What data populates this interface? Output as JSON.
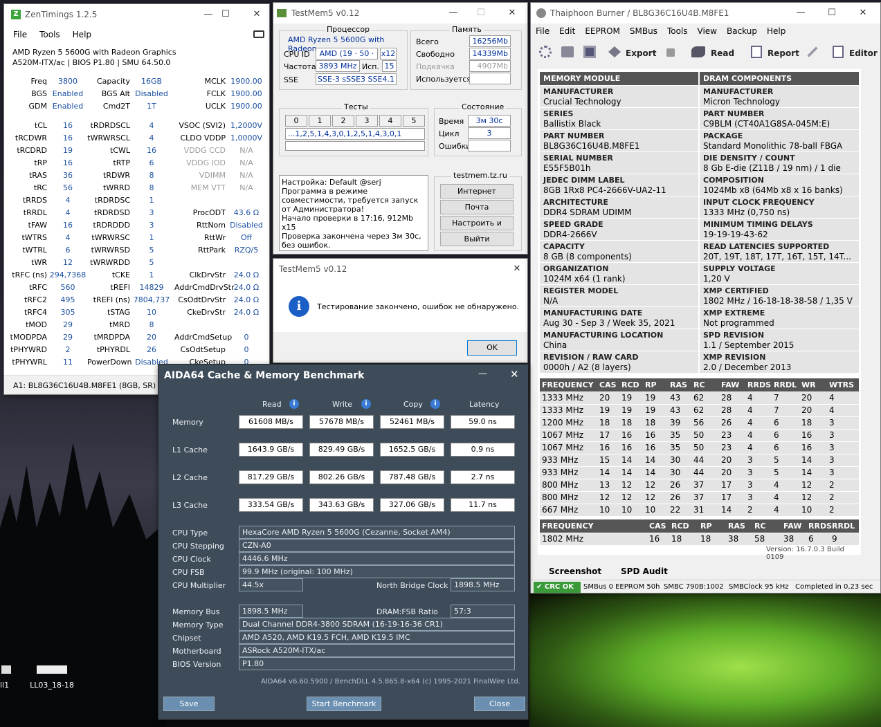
{
  "desktop": {
    "icon1_label": "ll1",
    "icon2_label": "LL03_18-18"
  },
  "zen": {
    "title": "ZenTimings 1.2.5",
    "menu": [
      "File",
      "Tools",
      "Help"
    ],
    "cpu": "AMD Ryzen 5 5600G with Radeon Graphics",
    "board": "A520M-ITX/ac | BIOS P1.80 | SMU 64.50.0",
    "status": "A1: BL8G36C16U4B.M8FE1 (8GB, SR)",
    "rows1": [
      [
        "Freq",
        "3800",
        "Capacity",
        "16GB",
        "MCLK",
        "1900.00"
      ],
      [
        "BGS",
        "Enabled",
        "BGS Alt",
        "Disabled",
        "FCLK",
        "1900.00"
      ],
      [
        "GDM",
        "Enabled",
        "Cmd2T",
        "1T",
        "UCLK",
        "1900.00"
      ]
    ],
    "rows2": [
      [
        "tCL",
        "16",
        "tRDRDSCL",
        "4",
        "VSOC (SVI2)",
        "1,2000V"
      ],
      [
        "tRCDWR",
        "16",
        "tWRWRSCL",
        "4",
        "CLDO VDDP",
        "1,0000V"
      ],
      [
        "tRCDRD",
        "19",
        "tCWL",
        "16",
        "VDDG CCD",
        "N/A"
      ],
      [
        "tRP",
        "16",
        "tRTP",
        "6",
        "VDDG IOD",
        "N/A"
      ],
      [
        "tRAS",
        "36",
        "tRDWR",
        "8",
        "VDIMM",
        "N/A"
      ],
      [
        "tRC",
        "56",
        "tWRRD",
        "8",
        "MEM VTT",
        "N/A"
      ],
      [
        "tRRDS",
        "4",
        "tRDRDSC",
        "1",
        "",
        ""
      ],
      [
        "tRRDL",
        "4",
        "tRDRDSD",
        "3",
        "ProcODT",
        "43.6 Ω"
      ],
      [
        "tFAW",
        "16",
        "tRDRDDD",
        "3",
        "RttNom",
        "Disabled"
      ],
      [
        "tWTRS",
        "4",
        "tWRWRSC",
        "1",
        "RttWr",
        "Off"
      ],
      [
        "tWTRL",
        "6",
        "tWRWRSD",
        "5",
        "RttPark",
        "RZQ/5"
      ],
      [
        "tWR",
        "12",
        "tWRWRDD",
        "5",
        "",
        ""
      ],
      [
        "tRFC (ns)",
        "294,7368",
        "tCKE",
        "1",
        "ClkDrvStr",
        "24.0 Ω"
      ],
      [
        "tRFC",
        "560",
        "tREFI",
        "14829",
        "AddrCmdDrvStr",
        "24.0 Ω"
      ],
      [
        "tRFC2",
        "495",
        "tREFI (ns)",
        "7804,737",
        "CsOdtDrvStr",
        "24.0 Ω"
      ],
      [
        "tRFC4",
        "305",
        "tSTAG",
        "10",
        "CkeDrvStr",
        "24.0 Ω"
      ],
      [
        "tMOD",
        "29",
        "tMRD",
        "8",
        "",
        ""
      ],
      [
        "tMODPDA",
        "29",
        "tMRDPDA",
        "20",
        "AddrCmdSetup",
        "0"
      ],
      [
        "tPHYWRD",
        "2",
        "tPHYRDL",
        "26",
        "CsOdtSetup",
        "0"
      ],
      [
        "tPHYWRL",
        "11",
        "PowerDown",
        "Disabled",
        "CkeSetup",
        "0"
      ]
    ]
  },
  "tm5": {
    "title": "TestMem5 v0.12",
    "proc_group": "Процессор",
    "cpu": "AMD Ryzen 5 5600G with Radeon",
    "cpu_id_label": "CPU ID",
    "cpu_id": "AMD  (19 · 50 · 0)",
    "cpu_id_x": "x12",
    "freq_label": "Частота",
    "freq": "3893 MHz",
    "isp_label": "Исп.",
    "isp": "15",
    "sse_label": "SSE",
    "sse": "SSE-3 sSSE3 SSE4.1",
    "mem_group": "Память",
    "total_label": "Всего",
    "total": "16256Mb",
    "free_label": "Свободно",
    "free": "14339Mb",
    "swap_label": "Подкачка",
    "swap": "4907Mb",
    "used_label": "Используется",
    "used": "",
    "tests_group": "Тесты",
    "tests": [
      "0",
      "1",
      "2",
      "3",
      "4",
      "5"
    ],
    "sequence": "...1,2,5,1,4,3,0,1,2,5,1,4,3,0,1",
    "state_group": "Состояние",
    "time_label": "Время",
    "time": "3м 30с",
    "cycle_label": "Цикл",
    "cycle": "3",
    "errors_label": "Ошибки",
    "errors": "",
    "log": "Настройка: Default @serj\nПрограмма в режиме совместимости, требуется запуск от Администратора!\nНачало проверки в 17:16, 912Mb x15\nПроверка закончена через 3м 30с, без ошибок.",
    "site": "testmem.tz.ru",
    "btn_internet": "Интернет",
    "btn_mail": "Почта",
    "btn_setup_exit": "Настроить и выйти",
    "btn_exit": "Выйти"
  },
  "dlg": {
    "title": "TestMem5 v0.12",
    "message": "Тестирование закончено, ошибок не обнаружено.",
    "ok": "OK"
  },
  "thai": {
    "title": "Thaiphoon Burner / BL8G36C16U4B.M8FE1",
    "menu": [
      "File",
      "Edit",
      "EEPROM",
      "SMBus",
      "Tools",
      "View",
      "Backup",
      "Help"
    ],
    "export": "Export",
    "read": "Read",
    "report": "Report",
    "editor": "Editor",
    "left_header": "MEMORY MODULE",
    "right_header": "DRAM COMPONENTS",
    "left": [
      [
        "MANUFACTURER",
        "Crucial Technology"
      ],
      [
        "SERIES",
        "Ballistix Black"
      ],
      [
        "PART NUMBER",
        "BL8G36C16U4B.M8FE1"
      ],
      [
        "SERIAL NUMBER",
        "E55F5B01h"
      ],
      [
        "JEDEC DIMM LABEL",
        "8GB 1Rx8 PC4-2666V-UA2-11"
      ],
      [
        "ARCHITECTURE",
        "DDR4 SDRAM UDIMM"
      ],
      [
        "SPEED GRADE",
        "DDR4-2666V"
      ],
      [
        "CAPACITY",
        "8 GB (8 components)"
      ],
      [
        "ORGANIZATION",
        "1024M x64 (1 rank)"
      ],
      [
        "REGISTER MODEL",
        "N/A"
      ],
      [
        "MANUFACTURING DATE",
        "Aug 30 - Sep 3 / Week 35, 2021"
      ],
      [
        "MANUFACTURING LOCATION",
        "China"
      ],
      [
        "REVISION / RAW CARD",
        "0000h / A2 (8 layers)"
      ]
    ],
    "right": [
      [
        "MANUFACTURER",
        "Micron Technology"
      ],
      [
        "PART NUMBER",
        "C9BLM (CT40A1G8SA-045M:E)"
      ],
      [
        "PACKAGE",
        "Standard Monolithic 78-ball FBGA"
      ],
      [
        "DIE DENSITY / COUNT",
        "8 Gb E-die (Z11B / 19 nm) / 1 die"
      ],
      [
        "COMPOSITION",
        "1024Mb x8 (64Mb x8 x 16 banks)"
      ],
      [
        "INPUT CLOCK FREQUENCY",
        "1333 MHz (0,750 ns)"
      ],
      [
        "MINIMUM TIMING DELAYS",
        "19-19-19-43-62"
      ],
      [
        "READ LATENCIES SUPPORTED",
        "20T, 19T, 18T, 17T, 16T, 15T, 14T..."
      ],
      [
        "SUPPLY VOLTAGE",
        "1,20 V"
      ],
      [
        "XMP CERTIFIED",
        "1802 MHz / 16-18-18-38-58 / 1,35 V"
      ],
      [
        "XMP EXTREME",
        "Not programmed"
      ],
      [
        "SPD REVISION",
        "1.1 / September 2015"
      ],
      [
        "XMP REVISION",
        "2.0 / December 2013"
      ]
    ],
    "freq_headers": [
      "FREQUENCY",
      "CAS",
      "RCD",
      "RP",
      "RAS",
      "RC",
      "FAW",
      "RRDS",
      "RRDL",
      "WR",
      "WTRS"
    ],
    "freq_rows": [
      [
        "1333 MHz",
        "20",
        "19",
        "19",
        "43",
        "62",
        "28",
        "4",
        "7",
        "20",
        "4"
      ],
      [
        "1333 MHz",
        "19",
        "19",
        "19",
        "43",
        "62",
        "28",
        "4",
        "7",
        "20",
        "4"
      ],
      [
        "1200 MHz",
        "18",
        "18",
        "18",
        "39",
        "56",
        "26",
        "4",
        "6",
        "18",
        "3"
      ],
      [
        "1067 MHz",
        "17",
        "16",
        "16",
        "35",
        "50",
        "23",
        "4",
        "6",
        "16",
        "3"
      ],
      [
        "1067 MHz",
        "16",
        "16",
        "16",
        "35",
        "50",
        "23",
        "4",
        "6",
        "16",
        "3"
      ],
      [
        "933 MHz",
        "15",
        "14",
        "14",
        "30",
        "44",
        "20",
        "3",
        "5",
        "14",
        "3"
      ],
      [
        "933 MHz",
        "14",
        "14",
        "14",
        "30",
        "44",
        "20",
        "3",
        "5",
        "14",
        "3"
      ],
      [
        "800 MHz",
        "13",
        "12",
        "12",
        "26",
        "37",
        "17",
        "3",
        "4",
        "12",
        "2"
      ],
      [
        "800 MHz",
        "12",
        "12",
        "12",
        "26",
        "37",
        "17",
        "3",
        "4",
        "12",
        "2"
      ],
      [
        "667 MHz",
        "10",
        "10",
        "10",
        "22",
        "31",
        "14",
        "2",
        "4",
        "10",
        "2"
      ]
    ],
    "xmp_headers": [
      "FREQUENCY",
      "CAS",
      "RCD",
      "RP",
      "RAS",
      "RC",
      "FAW",
      "RRDS",
      "RRDL"
    ],
    "xmp_row": [
      "1802 MHz",
      "16",
      "18",
      "18",
      "38",
      "58",
      "38",
      "6",
      "9"
    ],
    "version": "Version: 16.7.0.3 Build 0109",
    "tab_screenshot": "Screenshot",
    "tab_spd": "SPD Audit",
    "status": [
      "CRC OK",
      "SMBus 0 EEPROM 50h",
      "SMBC 790B:1002",
      "SMBClock 95 kHz",
      "Completed in 0,23 sec"
    ]
  },
  "aida": {
    "title": "AIDA64 Cache & Memory Benchmark",
    "col_read": "Read",
    "col_write": "Write",
    "col_copy": "Copy",
    "col_latency": "Latency",
    "rows": [
      [
        "Memory",
        "61608 MB/s",
        "57678 MB/s",
        "52461 MB/s",
        "59.0 ns"
      ],
      [
        "L1 Cache",
        "1643.9 GB/s",
        "829.49 GB/s",
        "1652.5 GB/s",
        "0.9 ns"
      ],
      [
        "L2 Cache",
        "817.29 GB/s",
        "802.26 GB/s",
        "787.48 GB/s",
        "2.7 ns"
      ],
      [
        "L3 Cache",
        "333.54 GB/s",
        "343.63 GB/s",
        "327.06 GB/s",
        "11.7 ns"
      ]
    ],
    "cpu_type_label": "CPU Type",
    "cpu_type": "HexaCore AMD Ryzen 5 5600G  (Cezanne, Socket AM4)",
    "cpu_step_label": "CPU Stepping",
    "cpu_step": "CZN-A0",
    "cpu_clock_label": "CPU Clock",
    "cpu_clock": "4446.6 MHz",
    "cpu_fsb_label": "CPU FSB",
    "cpu_fsb": "99.9 MHz  (original: 100 MHz)",
    "cpu_mult_label": "CPU Multiplier",
    "cpu_mult": "44.5x",
    "nb_label": "North Bridge Clock",
    "nb": "1898.5 MHz",
    "mem_bus_label": "Memory Bus",
    "mem_bus": "1898.5 MHz",
    "dram_label": "DRAM:FSB Ratio",
    "dram": "57:3",
    "mem_type_label": "Memory Type",
    "mem_type": "Dual Channel DDR4-3800 SDRAM  (16-19-16-36 CR1)",
    "chipset_label": "Chipset",
    "chipset": "AMD A520, AMD K19.5 FCH, AMD K19.5 IMC",
    "mobo_label": "Motherboard",
    "mobo": "ASRock A520M-ITX/ac",
    "bios_label": "BIOS Version",
    "bios": "P1.80",
    "footer": "AIDA64 v6.60.5900 / BenchDLL 4.5.865.8-x64  (c) 1995-2021 FinalWire Ltd.",
    "save": "Save",
    "start": "Start Benchmark",
    "close": "Close"
  }
}
